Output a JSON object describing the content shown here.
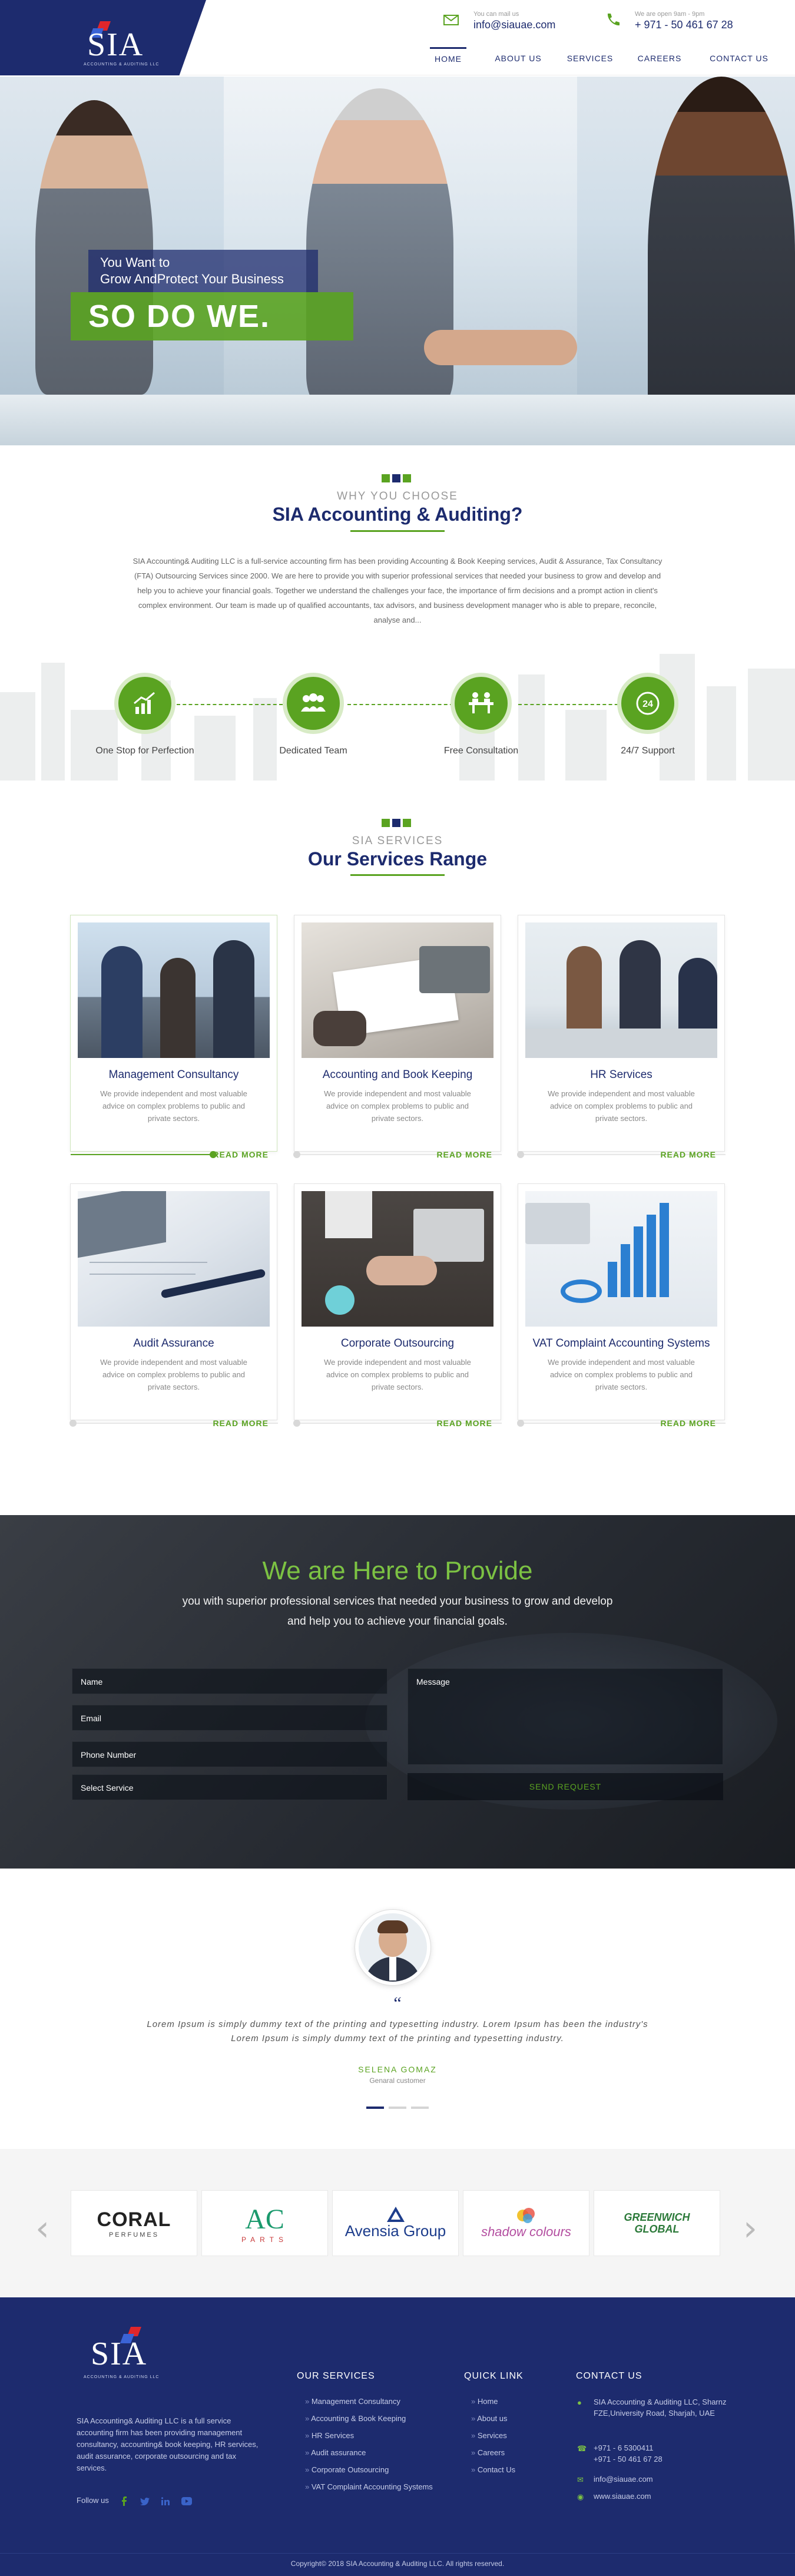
{
  "header": {
    "logo_text": "SIA",
    "logo_sub": "ACCOUNTING & AUDITING LLC",
    "mail_label": "You can mail us",
    "mail_value": "info@siauae.com",
    "phone_label": "We are open 9am - 9pm",
    "phone_value": "+ 971 - 50 461 67 28",
    "nav": [
      "HOME",
      "ABOUT US",
      "SERVICES",
      "CAREERS",
      "CONTACT US"
    ]
  },
  "hero": {
    "line1": "You Want to",
    "line2": "Grow AndProtect Your Business",
    "headline": "SO DO WE."
  },
  "why": {
    "kicker": "WHY YOU CHOOSE",
    "title": "SIA Accounting & Auditing?",
    "text": "SIA Accounting& Auditing LLC is a full-service accounting firm has been providing Accounting & Book Keeping services, Audit & Assurance, Tax Consultancy (FTA) Outsourcing Services since 2000. We are here to provide you with superior professional services that needed your business to grow and develop and help you to achieve your financial goals. Together we understand the challenges your face, the importance of firm decisions and a prompt action in client's complex environment. Our team is made up of qualified accountants, tax advisors, and business development manager who is able to prepare, reconcile, analyse and...",
    "features": [
      "One Stop for Perfection",
      "Dedicated Team",
      "Free Consultation",
      "24/7 Support"
    ]
  },
  "services": {
    "kicker": "SIA SERVICES",
    "title": "Our Services Range",
    "description": "We provide independent and most valuable advice on complex problems to public and private sectors.",
    "read_more": "READ MORE",
    "items": [
      {
        "title": "Management Consultancy"
      },
      {
        "title": "Accounting and Book Keeping"
      },
      {
        "title": "HR Services"
      },
      {
        "title": "Audit Assurance"
      },
      {
        "title": "Corporate Outsourcing"
      },
      {
        "title": "VAT Complaint Accounting Systems"
      }
    ]
  },
  "form": {
    "title": "We are Here to Provide",
    "subtitle_1": "you with superior professional services that needed your business to grow and develop",
    "subtitle_2": "and help you to achieve your financial goals.",
    "name": "Name",
    "email": "Email",
    "phone": "Phone Number",
    "service": "Select Service",
    "message": "Message",
    "send": "SEND REQUEST"
  },
  "testimonial": {
    "quote_mark": "“",
    "quote": "Lorem Ipsum is simply dummy text of the printing and typesetting industry. Lorem Ipsum has been the industry's Lorem Ipsum is simply dummy text of the printing and typesetting industry.",
    "name": "SELENA GOMAZ",
    "role": "Genaral customer"
  },
  "clients": {
    "prev": "‹",
    "next": "›",
    "logos": [
      {
        "name": "CORAL",
        "sub": "PERFUMES",
        "color": "#222222"
      },
      {
        "name": "AC",
        "sub": "PARTS",
        "color": "#1b9a6d"
      },
      {
        "name": "Avensia Group",
        "sub": "",
        "color": "#1d3d8c"
      },
      {
        "name": "shadow colours",
        "sub": "",
        "color": "#b34ea0"
      },
      {
        "name": "GREENWICH GLOBAL",
        "sub": "",
        "color": "#2c7a3a"
      }
    ]
  },
  "footer": {
    "logo_text": "SIA",
    "logo_sub": "ACCOUNTING & AUDITING LLC",
    "about": "SIA Accounting& Auditing LLC is a full service accounting firm has been providing management consultancy, accounting& book keeping, HR services, audit assurance, corporate outsourcing and tax services.",
    "follow": "Follow us",
    "services_title": "OUR SERVICES",
    "services": [
      "Management Consultancy",
      "Accounting & Book Keeping",
      "HR Services",
      "Audit assurance",
      "Corporate Outsourcing",
      "VAT Complaint Accounting Systems"
    ],
    "quick_title": "QUICK LINK",
    "quick": [
      "Home",
      "About us",
      "Services",
      "Careers",
      "Contact Us"
    ],
    "contact_title": "CONTACT US",
    "address": "SIA Accounting & Auditing LLC, Sharnz FZE,University Road, Sharjah, UAE",
    "phone1": "+971 - 6 5300411",
    "phone2": "+971 - 50 461 67 28",
    "email": "info@siauae.com",
    "web": "www.siauae.com",
    "copyright": "Copyright© 2018 SIA Accounting & Auditing LLC. All rights reserved."
  },
  "colors": {
    "navy": "#1d2b6e",
    "green": "#5aa321",
    "light_green": "#7cc243"
  }
}
